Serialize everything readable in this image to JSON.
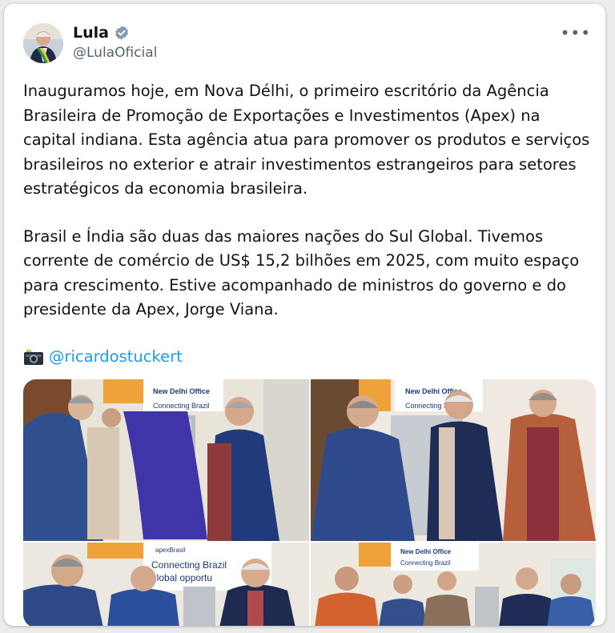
{
  "author": {
    "name": "Lula",
    "handle": "@LulaOficial",
    "verified_icon": "verified-badge-icon",
    "menu_icon": "more-options-icon"
  },
  "post": {
    "paragraph1": "Inauguramos hoje, em Nova Délhi, o primeiro escritório da Agência Brasileira de Promoção de Exportações e Investimentos (Apex) na capital indiana. Esta agência atua para promover os produtos e serviços brasileiros no exterior e atrair investimentos estrangeiros para setores estratégicos da economia brasileira.",
    "paragraph2": "Brasil e Índia são duas das maiores nações do Sul Global. Tivemos corrente de comércio de US$ 15,2 bilhões em 2025, com muito espaço para crescimento. Estive acompanhado de ministros do governo e do presidente da Apex, Jorge Viana.",
    "credit_mention": "@ricardostuckert"
  },
  "photos": {
    "signage_title": "New Delhi Office",
    "signage_brand": "apexBrasil",
    "signage_tagline": "Connecting Brazil",
    "signage_tagline_2": "Connecting Brazil",
    "signage_tagline_3": "global opportu"
  },
  "colors": {
    "accent": "#1d9bf0",
    "verified": "#829aab",
    "text": "#0f1419",
    "muted": "#536471"
  }
}
